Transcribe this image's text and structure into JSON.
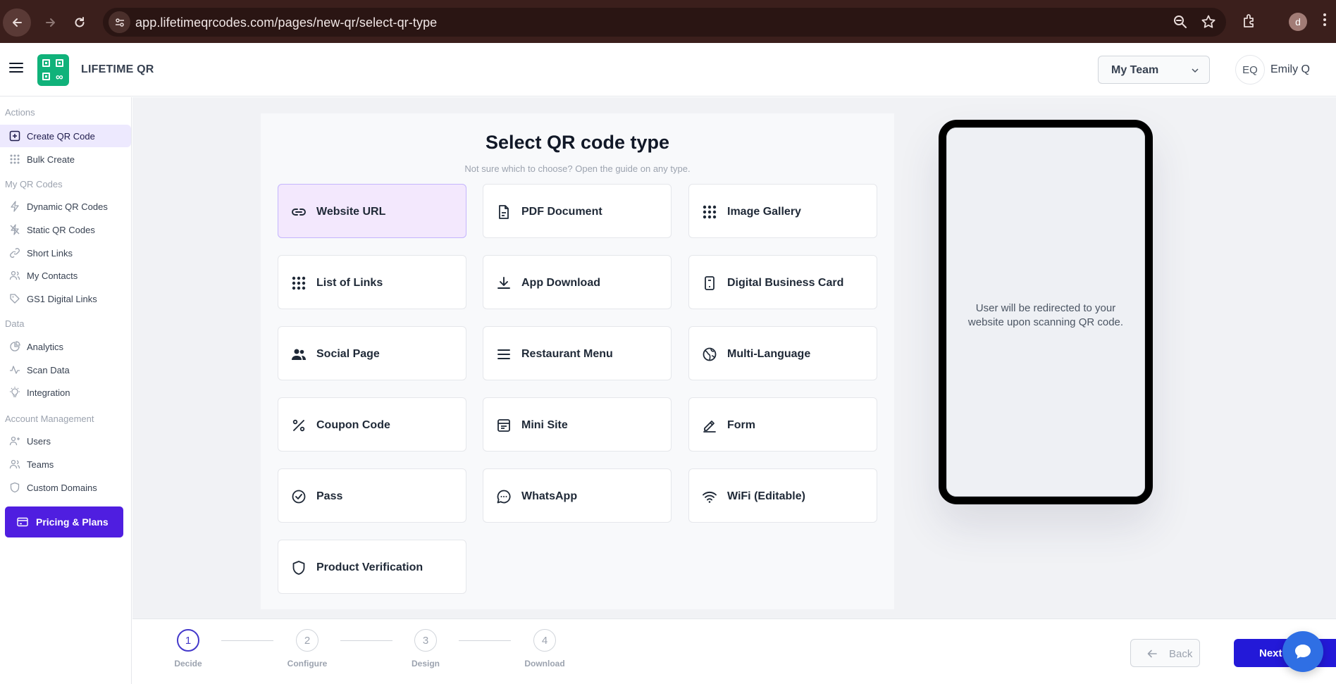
{
  "browser": {
    "url": "app.lifetimeqrcodes.com/pages/new-qr/select-qr-type",
    "profile_initial": "d"
  },
  "header": {
    "brand": "LIFETIME QR",
    "team_select": "My Team",
    "user_initials": "EQ",
    "user_name": "Emily Q"
  },
  "sidebar": {
    "sections": {
      "actions": "Actions",
      "my_qr_codes": "My QR Codes",
      "data": "Data",
      "account_management": "Account Management"
    },
    "items": {
      "create_qr": "Create QR Code",
      "bulk_create": "Bulk Create",
      "dynamic": "Dynamic QR Codes",
      "static": "Static QR Codes",
      "short_links": "Short Links",
      "contacts": "My Contacts",
      "gs1": "GS1 Digital Links",
      "analytics": "Analytics",
      "scan_data": "Scan Data",
      "integration": "Integration",
      "users": "Users",
      "teams": "Teams",
      "domains": "Custom Domains"
    },
    "pricing": "Pricing & Plans"
  },
  "main": {
    "title": "Select QR code type",
    "subtitle": "Not sure which to choose? Open the guide on any type.",
    "types": [
      {
        "label": "Website URL",
        "icon": "link-icon"
      },
      {
        "label": "PDF Document",
        "icon": "document-icon"
      },
      {
        "label": "Image Gallery",
        "icon": "grid-icon"
      },
      {
        "label": "List of Links",
        "icon": "grid-icon"
      },
      {
        "label": "App Download",
        "icon": "download-icon"
      },
      {
        "label": "Digital Business Card",
        "icon": "card-icon"
      },
      {
        "label": "Social Page",
        "icon": "users-icon"
      },
      {
        "label": "Restaurant Menu",
        "icon": "menu-lines-icon"
      },
      {
        "label": "Multi-Language",
        "icon": "globe-icon"
      },
      {
        "label": "Coupon Code",
        "icon": "percent-icon"
      },
      {
        "label": "Mini Site",
        "icon": "browser-icon"
      },
      {
        "label": "Form",
        "icon": "pen-icon"
      },
      {
        "label": "Pass",
        "icon": "check-circle-icon"
      },
      {
        "label": "WhatsApp",
        "icon": "chat-icon"
      },
      {
        "label": "WiFi (Editable)",
        "icon": "wifi-icon"
      },
      {
        "label": "Product Verification",
        "icon": "shield-icon"
      }
    ],
    "selected_type": "Website URL",
    "preview_message": "User will be redirected to your website upon scanning QR code."
  },
  "stepper": {
    "steps": [
      {
        "num": "1",
        "label": "Decide"
      },
      {
        "num": "2",
        "label": "Configure"
      },
      {
        "num": "3",
        "label": "Design"
      },
      {
        "num": "4",
        "label": "Download"
      }
    ],
    "back": "Back",
    "next": "Next"
  },
  "colors": {
    "primary": "#2319d8",
    "pricing": "#4f1ee0",
    "logo": "#10b27a",
    "selected_tile": "#f3e8fd"
  }
}
